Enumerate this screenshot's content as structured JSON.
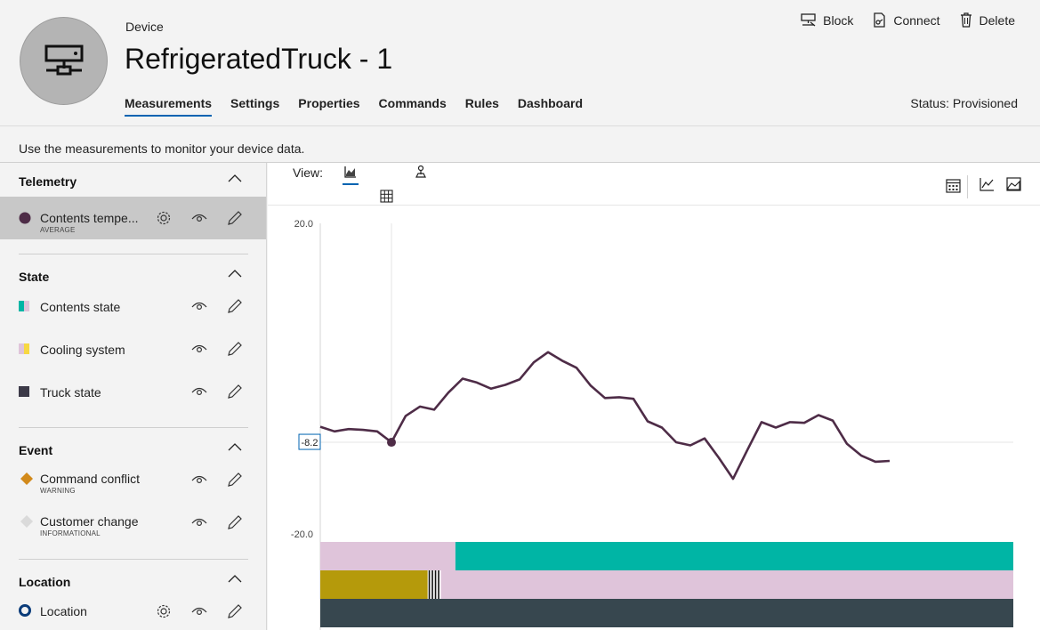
{
  "header": {
    "device_label": "Device",
    "title": "RefrigeratedTruck - 1",
    "tabs": [
      "Measurements",
      "Settings",
      "Properties",
      "Commands",
      "Rules",
      "Dashboard"
    ],
    "active_tab": "Measurements",
    "actions": {
      "block": "Block",
      "connect": "Connect",
      "delete": "Delete"
    },
    "status": "Status: Provisioned"
  },
  "description": "Use the measurements to monitor your device data.",
  "sidebar": {
    "telemetry": {
      "title": "Telemetry",
      "items": [
        {
          "label": "Contents tempe...",
          "sub": "AVERAGE",
          "color": "#4e2c47"
        }
      ]
    },
    "state": {
      "title": "State",
      "items": [
        {
          "label": "Contents state",
          "colors": [
            "#00b5a5",
            "#dfc4da"
          ]
        },
        {
          "label": "Cooling system",
          "colors": [
            "#dfc4da",
            "#f7d842"
          ]
        },
        {
          "label": "Truck state",
          "colors": [
            "#3c3a48",
            "#3c3a48"
          ]
        }
      ]
    },
    "event": {
      "title": "Event",
      "items": [
        {
          "label": "Command conflict",
          "sub": "WARNING",
          "color": "#d28a1b"
        },
        {
          "label": "Customer change",
          "sub": "INFORMATIONAL",
          "color": "#d9d9d9"
        }
      ]
    },
    "location": {
      "title": "Location",
      "items": [
        {
          "label": "Location"
        }
      ]
    }
  },
  "view": {
    "label": "View:"
  },
  "chart_data": {
    "type": "line",
    "ylim": [
      -20,
      20
    ],
    "y_ticks": [
      "20.0",
      "-20.0"
    ],
    "hover_value": "-8.2",
    "series": [
      {
        "color": "#4e2c47",
        "values": [
          -6.2,
          -6.8,
          -6.5,
          -6.6,
          -6.8,
          -8.2,
          -4.8,
          -3.6,
          -4.0,
          -1.8,
          0.0,
          -0.5,
          -1.3,
          -0.8,
          -0.1,
          2.1,
          3.4,
          2.3,
          1.4,
          -0.9,
          -2.5,
          -2.4,
          -2.6,
          -5.5,
          -6.3,
          -8.2,
          -8.6,
          -7.7,
          -10.2,
          -12.9,
          -9.2,
          -5.6,
          -6.3,
          -5.6,
          -5.7,
          -4.7,
          -5.4,
          -8.4,
          -9.9,
          -10.7,
          -10.6
        ]
      }
    ],
    "state_bands": [
      {
        "segments": [
          {
            "to": 0.195,
            "color": "#dfc4da"
          },
          {
            "to": 1.0,
            "color": "#00b5a5"
          }
        ]
      },
      {
        "segments": [
          {
            "to": 0.155,
            "color": "#b59a0b"
          },
          {
            "to": 0.174,
            "color": "#hatch"
          },
          {
            "to": 1.0,
            "color": "#dfc4da"
          }
        ]
      },
      {
        "segments": [
          {
            "to": 1.0,
            "color": "#37474f"
          }
        ]
      }
    ]
  }
}
